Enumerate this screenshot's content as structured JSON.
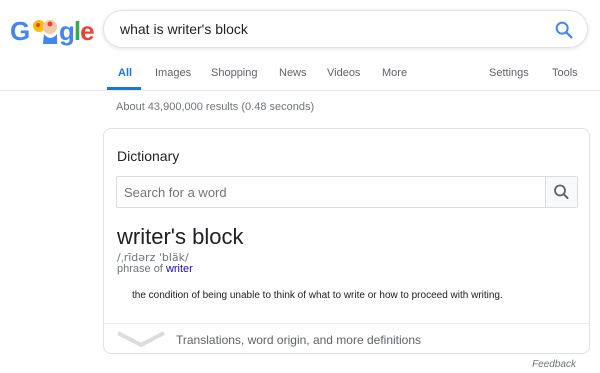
{
  "logo": {
    "text": "Google"
  },
  "search": {
    "query": "what is writer's block"
  },
  "tabs": [
    {
      "label": "All",
      "active": true
    },
    {
      "label": "Images"
    },
    {
      "label": "Shopping"
    },
    {
      "label": "News"
    },
    {
      "label": "Videos"
    },
    {
      "label": "More"
    },
    {
      "label": "Settings"
    },
    {
      "label": "Tools"
    }
  ],
  "result_stats": "About 43,900,000 results (0.48 seconds)",
  "dictionary": {
    "title": "Dictionary",
    "search_placeholder": "Search for a word",
    "headword": "writer's block",
    "pronunciation": "/ˌrīdərz ˈbläk/",
    "phrase_of_prefix": "phrase of",
    "phrase_of_link": "writer",
    "definition": "the condition of being unable to think of what to write or how to proceed with writing.",
    "more_label": "Translations, word origin, and more definitions"
  },
  "feedback": "Feedback",
  "colors": {
    "accent": "#1a73e8",
    "link": "#1a0dab",
    "muted": "#70757a"
  }
}
